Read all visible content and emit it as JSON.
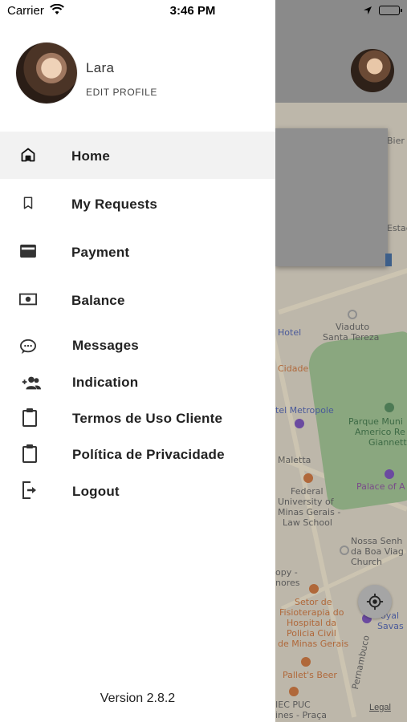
{
  "status_bar": {
    "carrier": "Carrier",
    "time": "3:46 PM"
  },
  "profile": {
    "name": "Lara",
    "edit_label": "EDIT PROFILE"
  },
  "menu": {
    "items": [
      {
        "label": "Home",
        "icon": "home-icon",
        "active": true
      },
      {
        "label": "My Requests",
        "icon": "bookmark-icon"
      },
      {
        "label": "Payment",
        "icon": "credit-card-icon"
      },
      {
        "label": "Balance",
        "icon": "money-icon"
      },
      {
        "label": "Messages",
        "icon": "chat-bubble-icon"
      },
      {
        "label": "Indication",
        "icon": "group-add-icon"
      },
      {
        "label": "Termos de Uso Cliente",
        "icon": "clipboard-icon"
      },
      {
        "label": "Política de Privacidade",
        "icon": "clipboard-icon"
      },
      {
        "label": "Logout",
        "icon": "logout-icon"
      }
    ]
  },
  "version": "Version 2.8.2",
  "map": {
    "labels": [
      "Bier",
      "Estad",
      "Hotel",
      "Viaduto",
      "Santa Tereza",
      "Cidade",
      "tel Metropole",
      "Parque Muni",
      "Americo Re",
      "Giannett",
      "Maletta",
      "Palace of A",
      "Federal",
      "University of",
      "Minas Gerais -",
      "Law School",
      "Nossa Senh",
      "da Boa Viag",
      "Church",
      "opy -",
      "nores",
      "Setor de",
      "Fisioterapia do",
      "Hospital da",
      "Policia Civil",
      "de Minas Gerais",
      "oyal",
      "Savas",
      "Pallet's Beer",
      "IEC PUC",
      "ines - Praça",
      "Pernambuco"
    ],
    "legal": "Legal",
    "locate_button": "locate-icon"
  },
  "colors": {
    "drawer_bg": "#ffffff",
    "active_item_bg": "#f2f2f2",
    "overlay": "#8a8a8a"
  }
}
